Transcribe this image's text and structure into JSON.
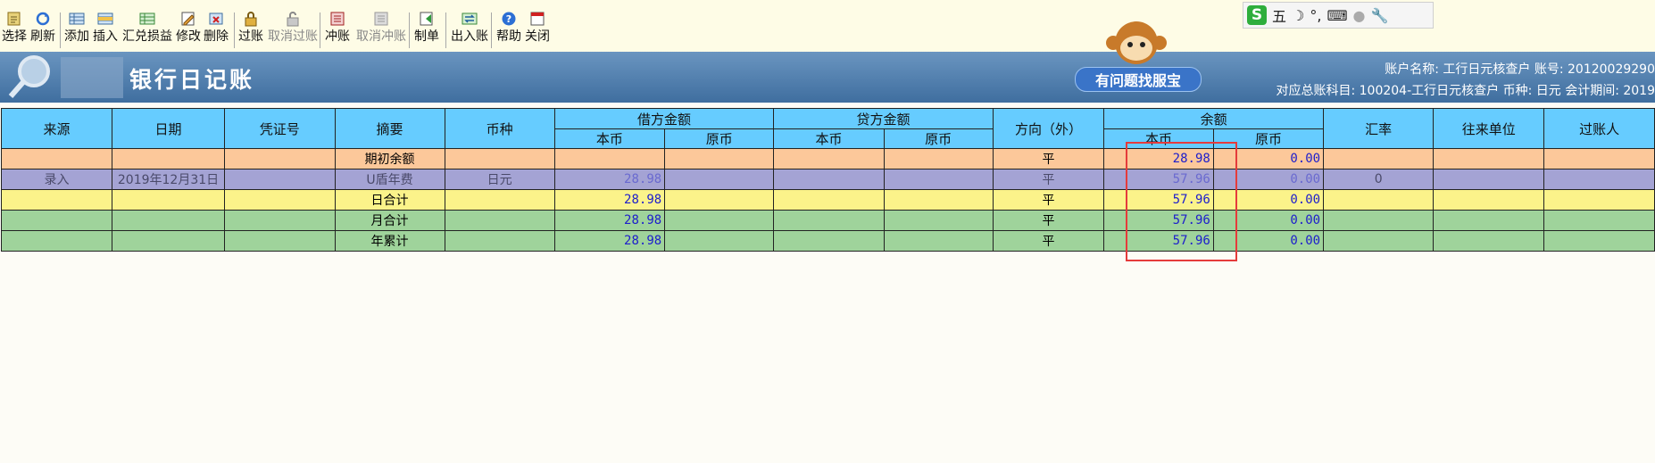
{
  "toolbar": {
    "buttons": [
      {
        "label": "选择"
      },
      {
        "label": "刷新"
      },
      {
        "label": "添加"
      },
      {
        "label": "插入"
      },
      {
        "label": "汇兑损益"
      },
      {
        "label": "修改"
      },
      {
        "label": "删除"
      },
      {
        "label": "过账"
      },
      {
        "label": "取消过账"
      },
      {
        "label": "冲账"
      },
      {
        "label": "取消冲账"
      },
      {
        "label": "制单"
      },
      {
        "label": "出入账"
      },
      {
        "label": "帮助"
      },
      {
        "label": "关闭"
      }
    ]
  },
  "ime": {
    "mode": "五",
    "icons": [
      "moon-icon",
      "punctuation-icon",
      "keyboard-icon",
      "user-icon",
      "wrench-icon"
    ]
  },
  "header": {
    "title": "银行日记账",
    "service_button": "有问题找服宝",
    "account_line": "账户名称: 工行日元核查户   账号: 20120029290",
    "subject_line": "对应总账科目: 100204-工行日元核查户   币种: 日元   会计期间: 2019"
  },
  "table": {
    "headers": {
      "source": "来源",
      "date": "日期",
      "voucher": "凭证号",
      "summary": "摘要",
      "currency": "币种",
      "debit": "借方金额",
      "credit": "贷方金额",
      "direction": "方向（外）",
      "balance": "余额",
      "rate": "汇率",
      "partner": "往来单位",
      "poster": "过账人",
      "local": "本币",
      "original": "原币"
    },
    "rows": [
      {
        "source": "",
        "date": "",
        "voucher": "",
        "summary": "期初余额",
        "currency": "",
        "debit_local": "",
        "debit_orig": "",
        "credit_local": "",
        "credit_orig": "",
        "direction": "平",
        "bal_local": "28.98",
        "bal_orig": "0.00",
        "rate": "",
        "partner": "",
        "poster": ""
      },
      {
        "source": "录入",
        "date": "2019年12月31日",
        "voucher": "",
        "summary": "U盾年费",
        "currency": "日元",
        "debit_local": "28.98",
        "debit_orig": "",
        "credit_local": "",
        "credit_orig": "",
        "direction": "平",
        "bal_local": "57.96",
        "bal_orig": "0.00",
        "rate": "0",
        "partner": "",
        "poster": ""
      },
      {
        "source": "",
        "date": "",
        "voucher": "",
        "summary": "日合计",
        "currency": "",
        "debit_local": "28.98",
        "debit_orig": "",
        "credit_local": "",
        "credit_orig": "",
        "direction": "平",
        "bal_local": "57.96",
        "bal_orig": "0.00",
        "rate": "",
        "partner": "",
        "poster": ""
      },
      {
        "source": "",
        "date": "",
        "voucher": "",
        "summary": "月合计",
        "currency": "",
        "debit_local": "28.98",
        "debit_orig": "",
        "credit_local": "",
        "credit_orig": "",
        "direction": "平",
        "bal_local": "57.96",
        "bal_orig": "0.00",
        "rate": "",
        "partner": "",
        "poster": ""
      },
      {
        "source": "",
        "date": "",
        "voucher": "",
        "summary": "年累计",
        "currency": "",
        "debit_local": "28.98",
        "debit_orig": "",
        "credit_local": "",
        "credit_orig": "",
        "direction": "平",
        "bal_local": "57.96",
        "bal_orig": "0.00",
        "rate": "",
        "partner": "",
        "poster": ""
      }
    ]
  }
}
